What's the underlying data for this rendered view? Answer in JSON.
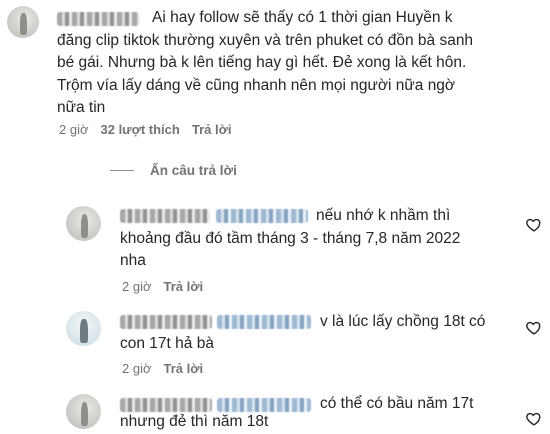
{
  "comments": [
    {
      "text_lines": [
        "Ai hay follow sẽ thấy có 1 thời gian Huyền k",
        "đăng clip tiktok thường xuyên và trên phuket có đồn bà sanh",
        "bé gái. Nhưng bà k lên tiếng hay gì hết. Đẻ xong là kết hôn.",
        "Trộm vía lấy dáng về cũng nhanh nên mọi người nữa ngờ",
        "nữa tin"
      ],
      "time": "2 giờ",
      "likes": "32 lượt thích",
      "reply_label": "Trả lời"
    }
  ],
  "hide_replies_label": "Ẩn câu trả lời",
  "replies": [
    {
      "text_lines": [
        "nếu nhớ k nhầm thì",
        "khoảng đầu đó tầm tháng 3 - tháng 7,8 năm 2022",
        "nha"
      ],
      "time": "2 giờ",
      "reply_label": "Trả lời"
    },
    {
      "text_lines": [
        "v là lúc lấy chồng 18t có",
        "con 17t hả bà"
      ],
      "time": "2 giờ",
      "reply_label": "Trả lời"
    },
    {
      "text_lines": [
        "có thể có bầu năm 17t",
        "nhưng đẻ thì năm 18t"
      ]
    }
  ],
  "icons": {
    "like": "heart-outline-icon"
  },
  "colors": {
    "text": "#262626",
    "secondary": "#737373",
    "background": "#ffffff"
  }
}
